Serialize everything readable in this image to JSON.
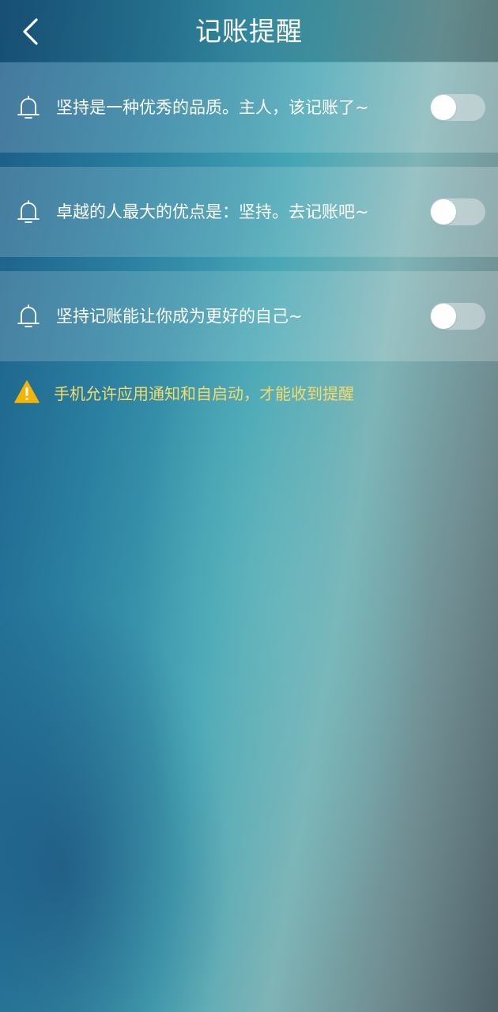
{
  "header": {
    "title": "记账提醒",
    "back_icon": "chevron-left-icon"
  },
  "reminders": [
    {
      "label": "坚持是一种优秀的品质。主人，该记账了~",
      "icon": "bell-icon",
      "enabled": false
    },
    {
      "label": "卓越的人最大的优点是：坚持。去记账吧~",
      "icon": "bell-icon",
      "enabled": false
    },
    {
      "label": "坚持记账能让你成为更好的自己~",
      "icon": "bell-icon",
      "enabled": false
    }
  ],
  "notice": {
    "icon": "warning-icon",
    "text": "手机允许应用通知和自启动，才能收到提醒",
    "color": "#f3dc6a"
  }
}
